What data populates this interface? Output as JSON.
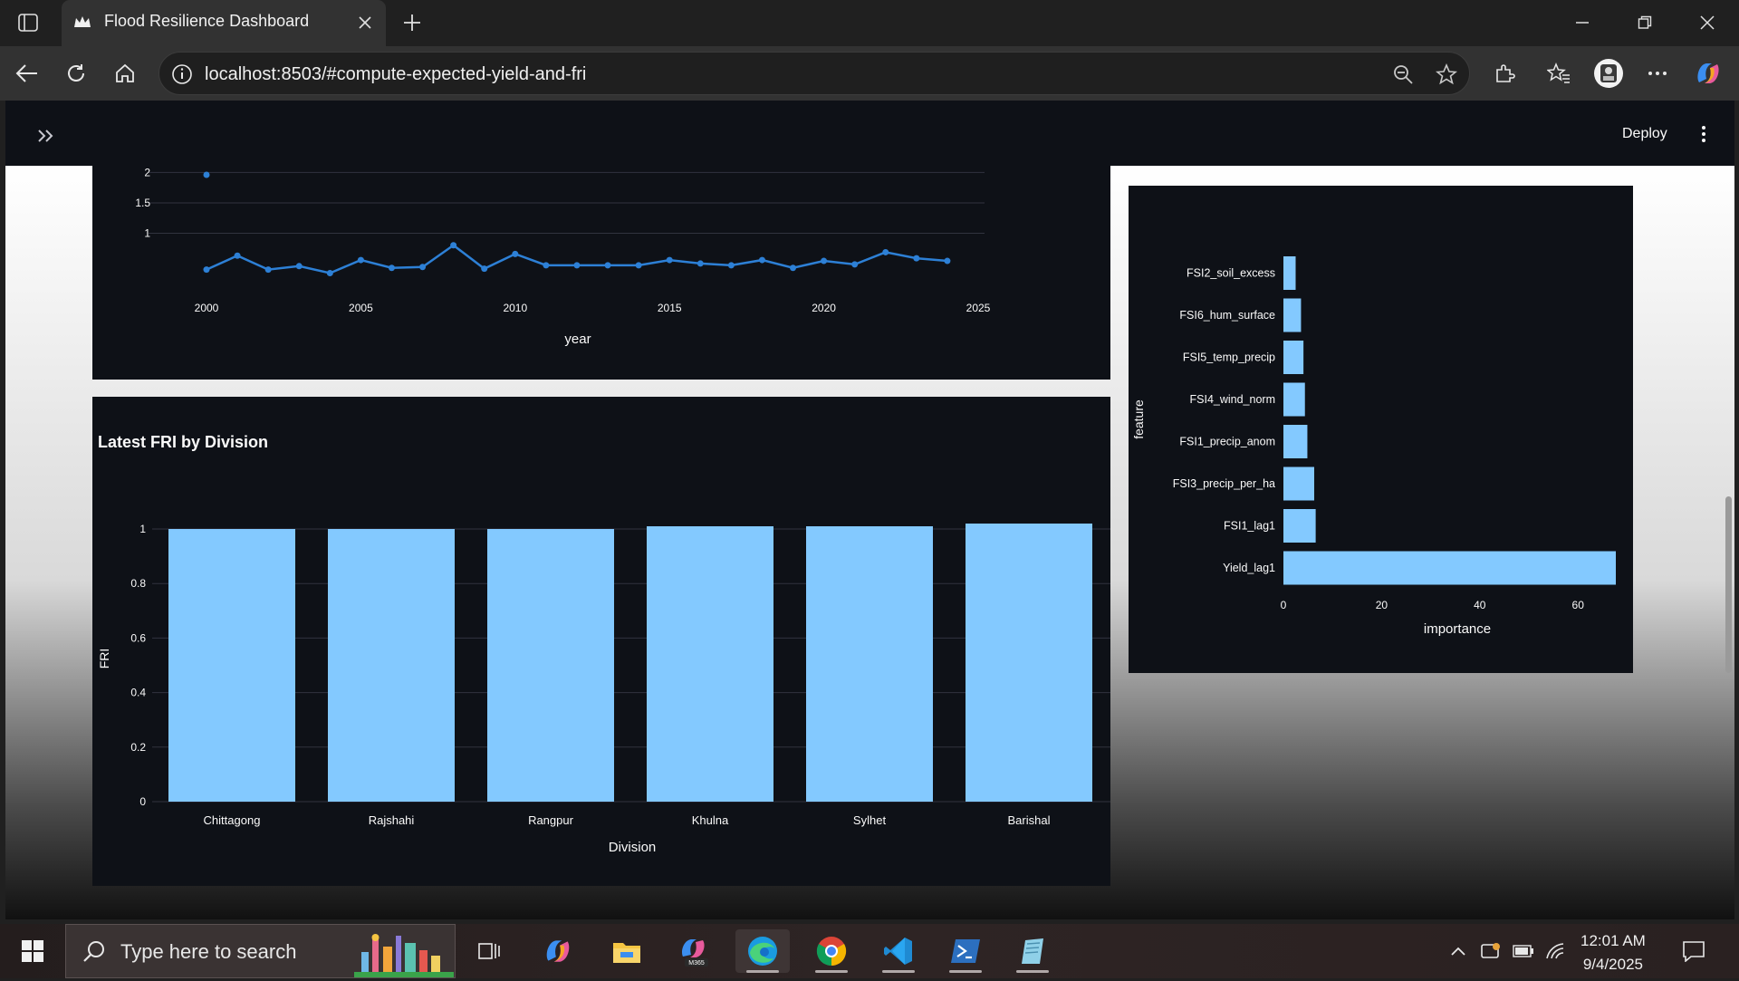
{
  "browser": {
    "tab_title": "Flood Resilience Dashboard",
    "url": "localhost:8503/#compute-expected-yield-and-fri"
  },
  "app": {
    "deploy_label": "Deploy"
  },
  "line_chart": {
    "xlabel": "year",
    "y_ticks": [
      "2",
      "1.5",
      "1"
    ],
    "x_ticks": [
      "2000",
      "2005",
      "2010",
      "2015",
      "2020",
      "2025"
    ]
  },
  "bar_chart": {
    "title": "Latest FRI by Division",
    "xlabel": "Division",
    "ylabel": "FRI",
    "y_ticks": [
      "1",
      "0.8",
      "0.6",
      "0.4",
      "0.2",
      "0"
    ]
  },
  "importance_chart": {
    "xlabel": "importance",
    "ylabel": "feature",
    "x_ticks": [
      "0",
      "20",
      "40",
      "60"
    ]
  },
  "chart_data": [
    {
      "type": "line",
      "xlabel": "year",
      "ylabel": "",
      "x": [
        2000,
        2001,
        2002,
        2003,
        2004,
        2005,
        2006,
        2007,
        2008,
        2009,
        2010,
        2011,
        2012,
        2013,
        2014,
        2015,
        2016,
        2017,
        2018,
        2019,
        2020,
        2021,
        2022,
        2023,
        2024
      ],
      "values": [
        0.91,
        1.07,
        0.91,
        0.95,
        0.87,
        1.02,
        0.93,
        0.94,
        1.19,
        0.92,
        1.09,
        0.96,
        0.96,
        0.96,
        0.96,
        1.02,
        0.98,
        0.96,
        1.02,
        0.93,
        1.01,
        0.97,
        1.11,
        1.04,
        1.01
      ],
      "ylim": [
        0.8,
        2.05
      ],
      "xlim": [
        1999.2,
        2025.3
      ],
      "grid": true
    },
    {
      "type": "bar",
      "title": "Latest FRI by Division",
      "xlabel": "Division",
      "ylabel": "FRI",
      "categories": [
        "Chittagong",
        "Rajshahi",
        "Rangpur",
        "Khulna",
        "Sylhet",
        "Barishal"
      ],
      "values": [
        1.0,
        1.0,
        1.0,
        1.01,
        1.01,
        1.02
      ],
      "ylim": [
        0,
        1.05
      ],
      "color": "#83c9ff",
      "grid": true
    },
    {
      "type": "bar",
      "orientation": "horizontal",
      "xlabel": "importance",
      "ylabel": "feature",
      "categories": [
        "FSI2_soil_excess",
        "FSI6_hum_surface",
        "FSI5_temp_precip",
        "FSI4_wind_norm",
        "FSI1_precip_anom",
        "FSI3_precip_per_ha",
        "FSI1_lag1",
        "Yield_lag1"
      ],
      "values": [
        2.5,
        3.6,
        4.1,
        4.4,
        4.9,
        6.3,
        6.6,
        68
      ],
      "xlim": [
        0,
        68
      ],
      "color": "#83c9ff"
    }
  ],
  "taskbar": {
    "search_placeholder": "Type here to search",
    "time": "12:01 AM",
    "date": "9/4/2025"
  }
}
